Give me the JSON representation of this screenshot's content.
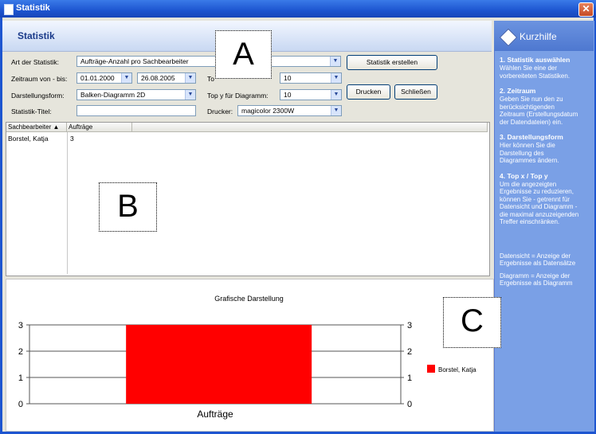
{
  "window": {
    "title": "Statistik",
    "close_glyph": "✕"
  },
  "header": {
    "title": "Statistik"
  },
  "form": {
    "art_label": "Art der Statistik:",
    "art_value": "Aufträge-Anzahl pro Sachbearbeiter",
    "zeitraum_label": "Zeitraum von - bis:",
    "date_from": "01.01.2000",
    "date_to": "26.08.2005",
    "top_x_label": "To",
    "top_x_value": "10",
    "darstellung_label": "Darstellungsform:",
    "darstellung_value": "Balken-Diagramm 2D",
    "top_y_label": "Top y für Diagramm:",
    "top_y_value": "10",
    "titel_label": "Statistik-Titel:",
    "titel_value": "",
    "drucker_label": "Drucker:",
    "drucker_value": "magicolor 2300W"
  },
  "buttons": {
    "create": "Statistik erstellen",
    "print": "Drucken",
    "close": "Schließen"
  },
  "markers": {
    "a": "A",
    "b": "B",
    "c": "C"
  },
  "grid": {
    "columns": [
      "Sachbearbeiter ▲",
      "Aufträge"
    ],
    "rows": [
      {
        "name": "Borstel, Katja",
        "count": "3"
      }
    ]
  },
  "chart_data": {
    "type": "bar",
    "title": "Grafische Darstellung",
    "categories": [
      "Aufträge"
    ],
    "series": [
      {
        "name": "Borstel, Katja",
        "values": [
          3
        ],
        "color": "#ff0000"
      }
    ],
    "ylim": [
      0,
      3
    ],
    "yticks": [
      "0",
      "1",
      "2",
      "3"
    ],
    "legend": "right"
  },
  "sidebar": {
    "title": "Kurzhilfe",
    "sections": [
      {
        "heading": "1. Statistik auswählen",
        "lines": [
          "Wählen Sie eine der",
          "vorbereiteten Statistiken."
        ]
      },
      {
        "heading": "2. Zeitraum",
        "lines": [
          "Geben Sie nun den zu",
          "berücksichtigenden",
          "Zeitraum (Erstellungsdatum",
          "der Datendateien) ein."
        ]
      },
      {
        "heading": "3. Darstellungsform",
        "lines": [
          "Hier können Sie die",
          "Darstellung des",
          "Diagrammes ändern."
        ]
      },
      {
        "heading": "4. Top x / Top y",
        "lines": [
          "Um die angezeigten",
          "Ergebnisse zu reduzieren,",
          "können Sie - getrennt für",
          "Datensicht und Diagramm -",
          "die maximal anzuzeigenden",
          "Treffer einschränken."
        ]
      }
    ],
    "notes": [
      [
        "Datensicht = Anzeige der",
        "Ergebnisse als Datensätze"
      ],
      [
        "Diagramm = Anzeige der",
        "Ergebnisse als Diagramm"
      ]
    ]
  }
}
